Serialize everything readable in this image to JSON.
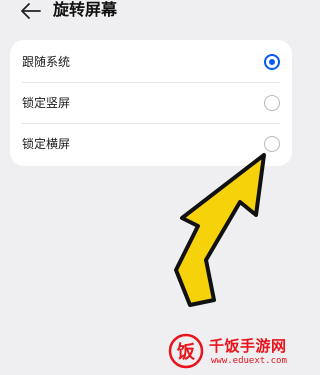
{
  "header": {
    "title": "旋转屏幕",
    "back_icon": "arrow-left-icon"
  },
  "options": [
    {
      "label": "跟随系统",
      "selected": true
    },
    {
      "label": "锁定竖屏",
      "selected": false
    },
    {
      "label": "锁定横屏",
      "selected": false
    }
  ],
  "colors": {
    "accent": "#0a59f7",
    "arrow_fill": "#f5d20a",
    "watermark": "#e8131c"
  },
  "watermark": {
    "logo_char": "饭",
    "name": "千饭手游网",
    "url": "www.eduext.com"
  }
}
